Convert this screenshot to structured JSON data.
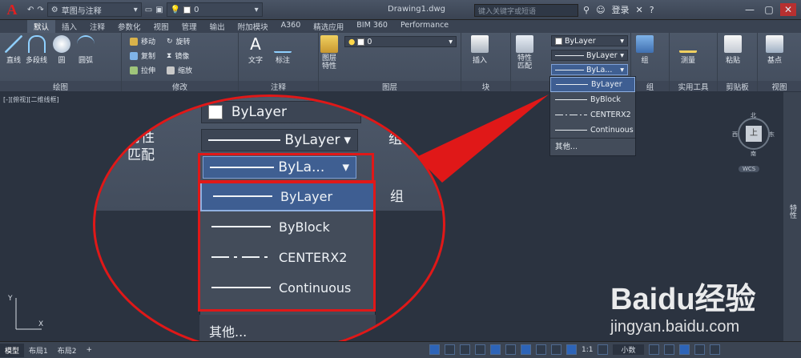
{
  "titlebar": {
    "app_letter": "A",
    "workspace": "草图与注释",
    "layer_value": "0",
    "document_title": "Drawing1.dwg",
    "search_placeholder": "键入关键字或短语",
    "login_label": "登录"
  },
  "tabs": [
    "默认",
    "插入",
    "注释",
    "参数化",
    "视图",
    "管理",
    "输出",
    "附加模块",
    "A360",
    "精选应用",
    "BIM 360",
    "Performance"
  ],
  "ribbon": {
    "draw_panel_title": "绘图",
    "modify_panel_title": "修改",
    "annotation_panel_title": "注释",
    "layers_panel_title": "图层",
    "block_panel_title": "块",
    "properties_panel_title": "特性",
    "groups_panel_title": "组",
    "utilities_panel_title": "实用工具",
    "clipboard_panel_title": "剪贴板",
    "view_panel_title": "视图",
    "draw_buttons": [
      "直线",
      "多段线",
      "圆",
      "圆弧"
    ],
    "modify_rows": [
      [
        "移动",
        "旋转"
      ],
      [
        "复制",
        "镜像"
      ],
      [
        "拉伸",
        "缩放"
      ]
    ],
    "annotation_buttons": [
      "文字",
      "标注"
    ],
    "layer_props": "图层\n特性",
    "insert_label": "插入",
    "match_props": "特性\n匹配",
    "group_label": "组",
    "measure_label": "测量",
    "paste_label": "粘贴",
    "base_label": "基点",
    "layer_combo_value": "0",
    "color_combo": "ByLayer",
    "linetype_combo": "ByLayer",
    "lineweight_combo": "ByLa..."
  },
  "linetype_dropdown": {
    "items": [
      {
        "label": "ByLayer",
        "style": "solid",
        "selected": true
      },
      {
        "label": "ByBlock",
        "style": "solid",
        "selected": false
      },
      {
        "label": "CENTERX2",
        "style": "dash",
        "selected": false
      },
      {
        "label": "Continuous",
        "style": "solid",
        "selected": false
      }
    ],
    "other_label": "其他..."
  },
  "zoom": {
    "color_combo": "ByLayer",
    "linetype_combo": "ByLayer",
    "lineweight_combo": "ByLa...",
    "props_label": "特性",
    "match_label": "匹配",
    "group_label": "组"
  },
  "canvas": {
    "view_label": "[-][俯视][二维线框]",
    "side_label": "特性",
    "viewcube": {
      "north": "北",
      "south": "南",
      "east": "东",
      "west": "西",
      "top": "上",
      "wcs": "WCS"
    }
  },
  "statusbar": {
    "tabs": [
      "模型",
      "布局1",
      "布局2"
    ],
    "scale": "1:1",
    "units": "小数"
  },
  "watermark": {
    "brand": "Baidu经验",
    "url": "jingyan.baidu.com"
  },
  "colors": {
    "accent_red": "#e01818",
    "selection_blue": "#3e5e92",
    "background": "#2b3340"
  }
}
